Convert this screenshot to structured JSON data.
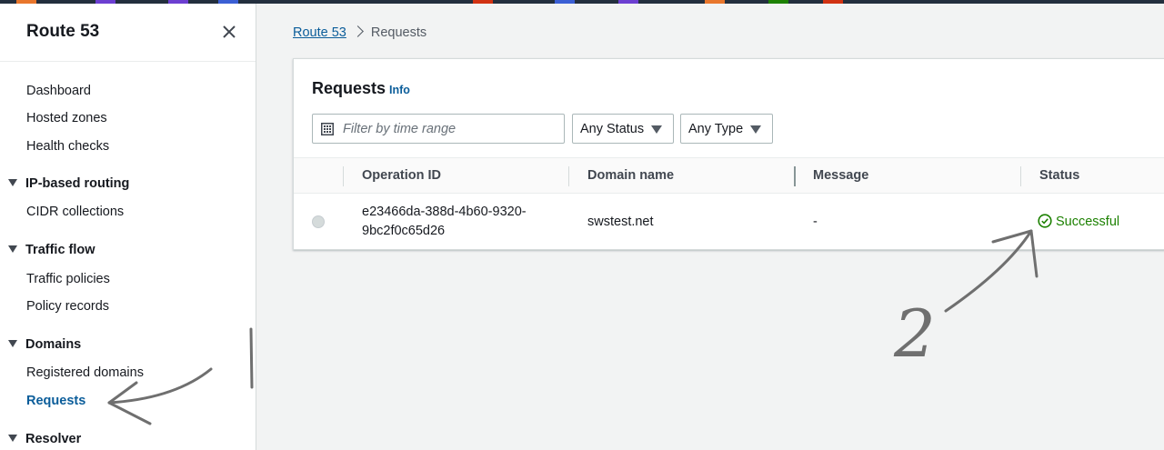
{
  "sidebar": {
    "title": "Route 53",
    "links": [
      {
        "label": "Dashboard"
      },
      {
        "label": "Hosted zones"
      },
      {
        "label": "Health checks"
      }
    ],
    "sections": [
      {
        "label": "IP-based routing",
        "items": [
          {
            "label": "CIDR collections"
          }
        ]
      },
      {
        "label": "Traffic flow",
        "items": [
          {
            "label": "Traffic policies"
          },
          {
            "label": "Policy records"
          }
        ]
      },
      {
        "label": "Domains",
        "items": [
          {
            "label": "Registered domains"
          },
          {
            "label": "Requests",
            "active": true
          }
        ]
      },
      {
        "label": "Resolver",
        "items": []
      }
    ]
  },
  "breadcrumb": {
    "root": "Route 53",
    "current": "Requests"
  },
  "panel": {
    "title": "Requests",
    "info": "Info",
    "filter": {
      "placeholder": "Filter by time range"
    },
    "status_select": "Any Status",
    "type_select": "Any Type",
    "columns": [
      "Operation ID",
      "Domain name",
      "Message",
      "Status"
    ],
    "rows": [
      {
        "operation_id_line1": "e23466da-388d-4b60-9320-",
        "operation_id_line2": "9bc2f0c65d26",
        "domain": "swstest.net",
        "message": "-",
        "status": "Successful"
      }
    ]
  },
  "annotations": {
    "number_label": "2"
  },
  "colors": {
    "link": "#0b5d9a",
    "success": "#1d8102",
    "annotation_ink": "#6f6f6f"
  }
}
